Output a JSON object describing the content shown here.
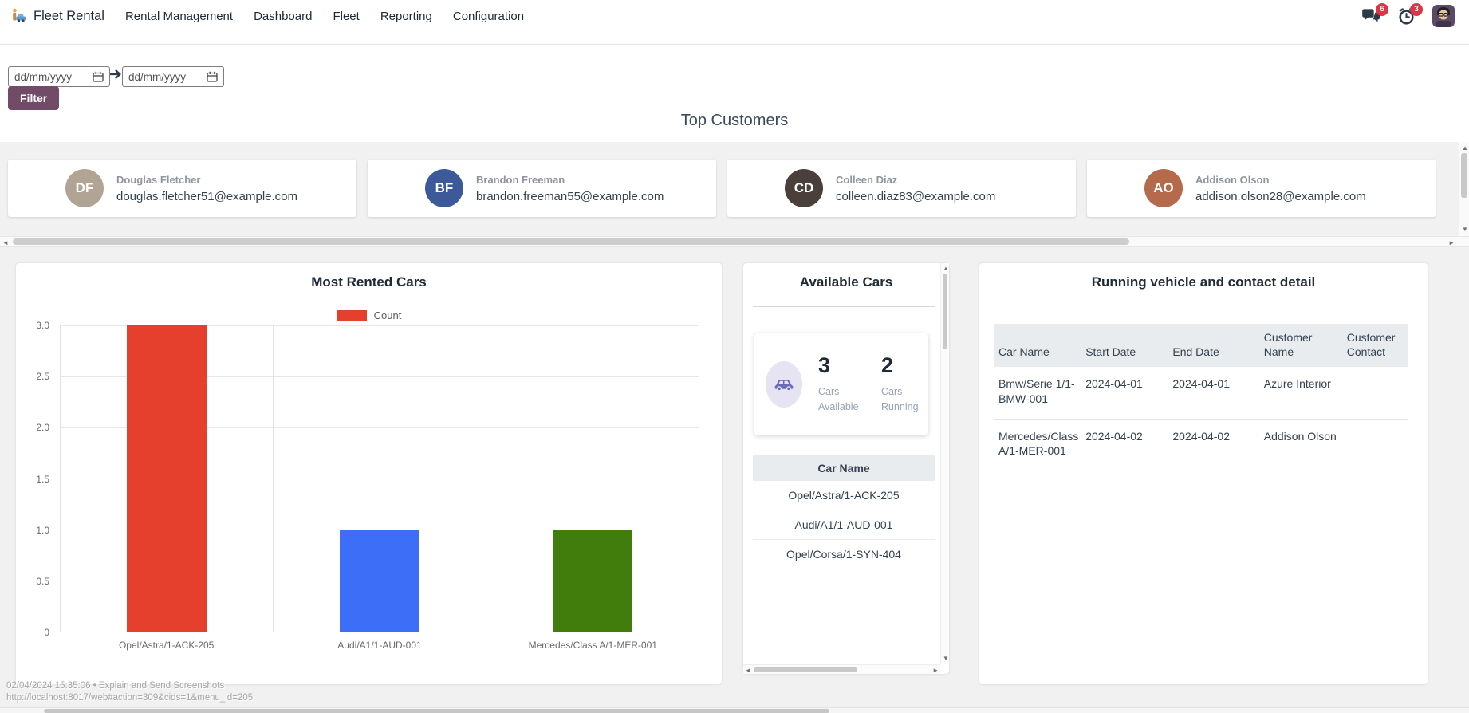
{
  "navbar": {
    "app_name": "Fleet Rental",
    "menus": [
      "Rental Management",
      "Dashboard",
      "Fleet",
      "Reporting",
      "Configuration"
    ],
    "messages_badge": "6",
    "activities_badge": "3"
  },
  "filter": {
    "start_date_placeholder": "dd/mm/yyyy",
    "end_date_placeholder": "dd/mm/yyyy",
    "button_label": "Filter"
  },
  "top_customers": {
    "title": "Top Customers",
    "customers": [
      {
        "name": "Douglas Fletcher",
        "email": "douglas.fletcher51@example.com",
        "initials": "DF",
        "avatar_color": "#b1a494"
      },
      {
        "name": "Brandon Freeman",
        "email": "brandon.freeman55@example.com",
        "initials": "BF",
        "avatar_color": "#3c5a99"
      },
      {
        "name": "Colleen Diaz",
        "email": "colleen.diaz83@example.com",
        "initials": "CD",
        "avatar_color": "#4a3f3a"
      },
      {
        "name": "Addison Olson",
        "email": "addison.olson28@example.com",
        "initials": "AO",
        "avatar_color": "#b56a4b"
      }
    ]
  },
  "chart_data": {
    "type": "bar",
    "title": "Most Rented Cars",
    "legend": [
      {
        "label": "Count",
        "color": "#e5402d"
      }
    ],
    "categories": [
      "Opel/Astra/1-ACK-205",
      "Audi/A1/1-AUD-001",
      "Mercedes/Class A/1-MER-001"
    ],
    "values": [
      3,
      1,
      1
    ],
    "colors": [
      "#e5402d",
      "#3d6ef7",
      "#417d0c"
    ],
    "xlabel": "",
    "ylabel": "",
    "ylim": [
      0,
      3
    ],
    "yticks": [
      "3.0",
      "2.5",
      "2.0",
      "1.5",
      "1.0",
      "0.5",
      "0"
    ],
    "grid": true,
    "legend_position": "top"
  },
  "available_cars": {
    "title": "Available Cars",
    "stats": [
      {
        "value": "3",
        "label": "Cars Available"
      },
      {
        "value": "2",
        "label": "Cars Running"
      }
    ],
    "table_header": "Car Name",
    "cars": [
      "Opel/Astra/1-ACK-205",
      "Audi/A1/1-AUD-001",
      "Opel/Corsa/1-SYN-404"
    ]
  },
  "running_table": {
    "title": "Running vehicle and contact detail",
    "columns": [
      "Car Name",
      "Start Date",
      "End Date",
      "Customer Name",
      "Customer Contact"
    ],
    "rows": [
      [
        "Bmw/Serie 1/1-BMW-001",
        "2024-04-01",
        "2024-04-01",
        "Azure Interior",
        ""
      ],
      [
        "Mercedes/Class A/1-MER-001",
        "2024-04-02",
        "2024-04-02",
        "Addison Olson",
        ""
      ]
    ]
  },
  "status_overlay": {
    "line1": "02/04/2024 15:35:06 • Explain and Send Screenshots",
    "line2": "http://localhost:8017/web#action=309&cids=1&menu_id=205"
  },
  "colors": {
    "primary": "#714B67",
    "badge": "#dc3545",
    "page_background": "#f1f1f1",
    "table_header_background": "#e9ecef",
    "stat_icon_background": "#e6e3f3",
    "stat_icon": "#6c6cb4"
  }
}
